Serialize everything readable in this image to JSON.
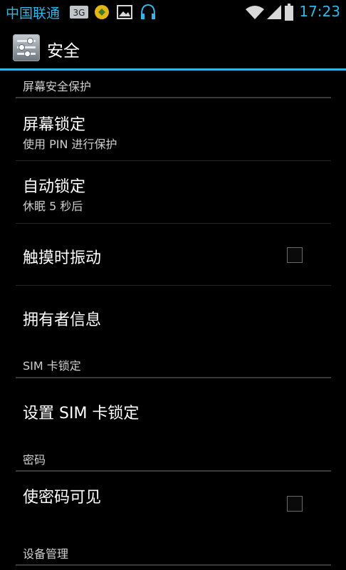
{
  "status_bar": {
    "carrier": "中国联通",
    "sim_badge": "3G",
    "time": "17:23",
    "icons": [
      "sim-3g-icon",
      "app-notification-icon",
      "image-icon",
      "headset-icon",
      "wifi-icon",
      "signal-icon",
      "battery-icon"
    ]
  },
  "action_bar": {
    "title": "安全",
    "icon": "settings-sliders-icon"
  },
  "sections": [
    {
      "header": "屏幕安全保护",
      "items": [
        {
          "title": "屏幕锁定",
          "summary": "使用 PIN 进行保护"
        },
        {
          "title": "自动锁定",
          "summary": "休眠 5 秒后"
        },
        {
          "title": "触摸时振动",
          "checkbox": false
        },
        {
          "title": "拥有者信息"
        }
      ]
    },
    {
      "header": "SIM 卡锁定",
      "items": [
        {
          "title": "设置 SIM 卡锁定"
        }
      ]
    },
    {
      "header": "密码",
      "items": [
        {
          "title": "使密码可见",
          "checkbox": false
        }
      ]
    },
    {
      "header": "设备管理",
      "items": []
    }
  ],
  "colors": {
    "accent": "#33b5e5",
    "background": "#000000",
    "text_primary": "#ffffff",
    "text_secondary": "#cfcfcf"
  }
}
